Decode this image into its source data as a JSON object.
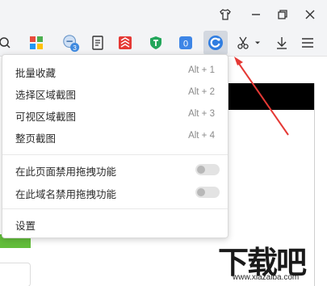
{
  "menu": {
    "items": [
      {
        "label": "批量收藏",
        "shortcut": "Alt + 1"
      },
      {
        "label": "选择区域截图",
        "shortcut": "Alt + 2"
      },
      {
        "label": "可视区域截图",
        "shortcut": "Alt + 3"
      },
      {
        "label": "整页截图",
        "shortcut": "Alt + 4"
      }
    ],
    "toggles": [
      {
        "label": "在此页面禁用拖拽功能",
        "enabled": false
      },
      {
        "label": "在此域名禁用拖拽功能",
        "enabled": false
      }
    ],
    "settings_label": "设置"
  },
  "toolbar": {
    "badge_count": "3",
    "extension_badge": "0"
  },
  "watermark": {
    "brand": "下载吧",
    "url": "www.xiazaiba.com"
  },
  "colors": {
    "arrow": "#e53935",
    "accent_blue": "#2f7de1",
    "green": "#62bd3a"
  }
}
